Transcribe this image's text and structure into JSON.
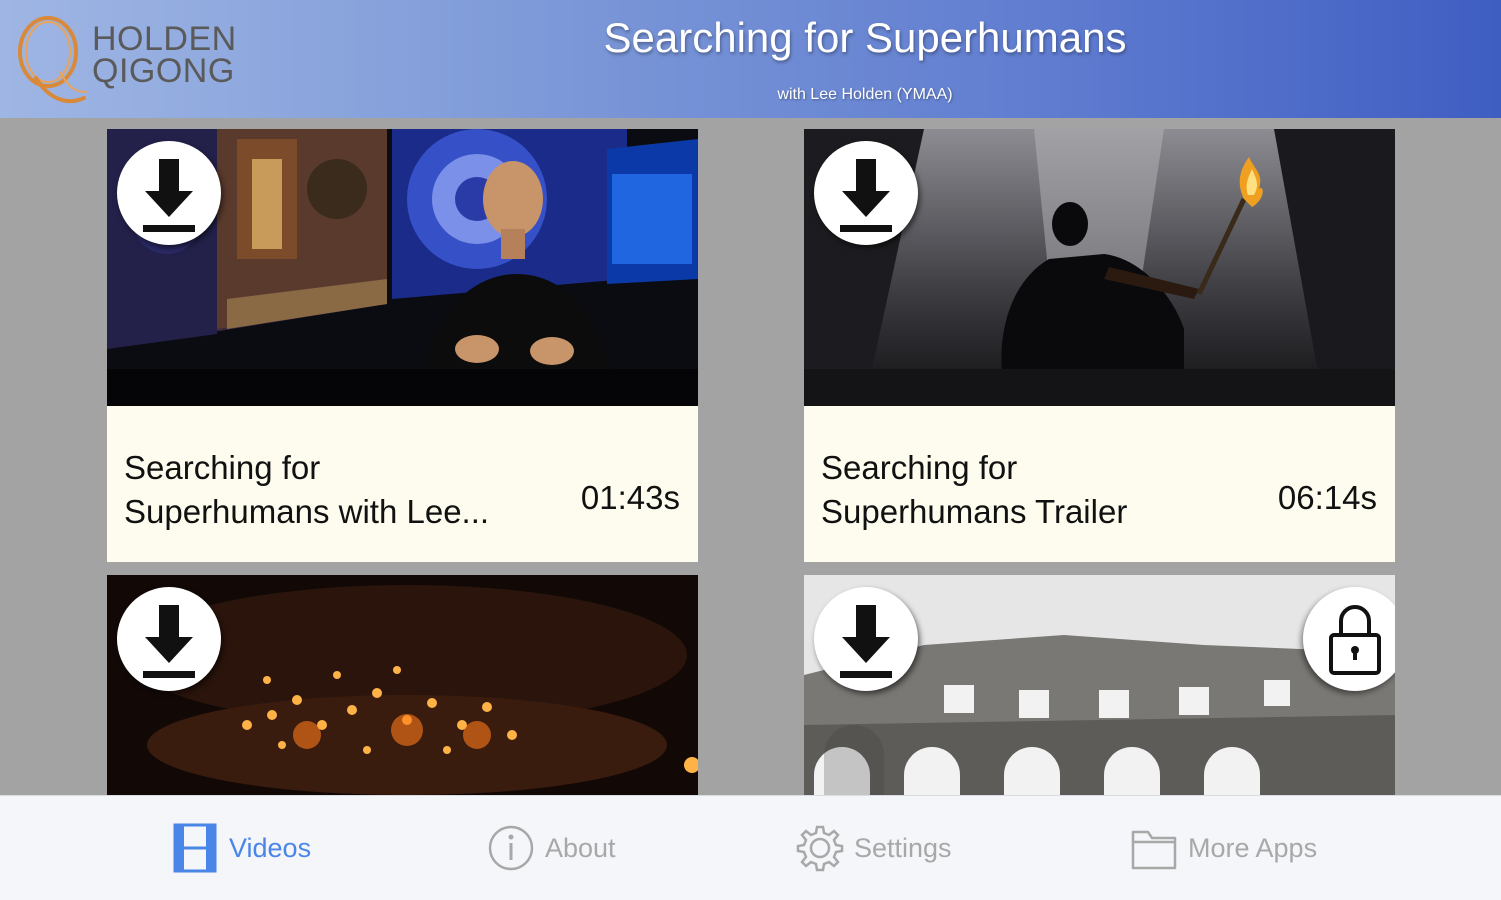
{
  "header": {
    "logo_line1": "HOLDEN",
    "logo_line2": "QIGONG",
    "title": "Searching for Superhumans",
    "subtitle": "with Lee Holden (YMAA)"
  },
  "videos": [
    {
      "title": "Searching for Superhumans with Lee...",
      "duration": "01:43s",
      "download_icon": "download-icon",
      "locked": false
    },
    {
      "title": "Searching for Superhumans Trailer",
      "duration": "06:14s",
      "download_icon": "download-icon",
      "locked": false
    },
    {
      "title": "",
      "duration": "",
      "download_icon": "download-icon",
      "locked": false
    },
    {
      "title": "",
      "duration": "",
      "download_icon": "download-icon",
      "locked": true,
      "lock_icon": "lock-icon"
    }
  ],
  "tabs": [
    {
      "label": "Videos",
      "icon": "film-icon",
      "active": true
    },
    {
      "label": "About",
      "icon": "info-icon",
      "active": false
    },
    {
      "label": "Settings",
      "icon": "gear-icon",
      "active": false
    },
    {
      "label": "More Apps",
      "icon": "folder-icon",
      "active": false
    }
  ],
  "colors": {
    "header_gradient_start": "#9fb6e4",
    "header_gradient_end": "#3f5ec2",
    "background": "#a3a3a3",
    "card_info_bg": "#fdfcee",
    "tab_active": "#4a86e8",
    "tab_inactive": "#a8a8a8",
    "logo_orange": "#d9893a"
  }
}
